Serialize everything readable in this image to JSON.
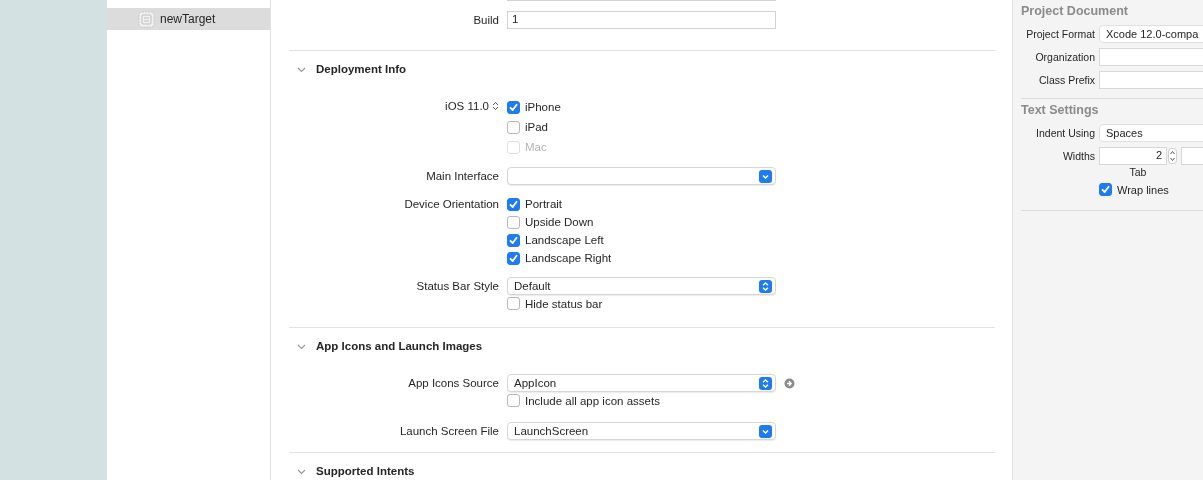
{
  "sidebar": {
    "items": [
      {
        "label": "newTarget",
        "selected": true
      }
    ]
  },
  "identity": {
    "rows": [
      {
        "kind": "field"
      },
      {
        "kind": "field",
        "label": "Build",
        "value": "1"
      }
    ]
  },
  "sections": [
    {
      "title": "Deployment Info",
      "expanded": true,
      "rows": [
        {
          "kind": "checks",
          "label": "iOS 11.0",
          "stepper": true,
          "options": [
            {
              "label": "iPhone",
              "checked": true,
              "disabled": false
            },
            {
              "label": "iPad",
              "checked": false,
              "disabled": false
            },
            {
              "label": "Mac",
              "checked": false,
              "disabled": true
            }
          ]
        },
        {
          "kind": "popup",
          "label": "Main Interface",
          "updown": false
        },
        {
          "kind": "checks",
          "label": "Device Orientation",
          "options": [
            {
              "label": "Portrait",
              "checked": true,
              "disabled": false
            },
            {
              "label": "Upside Down",
              "checked": false,
              "disabled": false
            },
            {
              "label": "Landscape Left",
              "checked": true,
              "disabled": false
            },
            {
              "label": "Landscape Right",
              "checked": true,
              "disabled": false
            }
          ]
        },
        {
          "kind": "popup",
          "label": "Status Bar Style",
          "value": "Default",
          "updown": true
        },
        {
          "kind": "check",
          "option": {
            "label": "Hide status bar",
            "checked": false,
            "disabled": false
          }
        }
      ]
    },
    {
      "title": "App Icons and Launch Images",
      "expanded": true,
      "rows": [
        {
          "kind": "popup",
          "label": "App Icons Source",
          "value": "AppIcon",
          "updown": true,
          "goto": true
        },
        {
          "kind": "check",
          "option": {
            "label": "Include all app icon assets",
            "checked": false,
            "disabled": false
          }
        },
        {
          "kind": "popup",
          "label": "Launch Screen File",
          "value": "LaunchScreen",
          "updown": false
        }
      ]
    },
    {
      "title": "Supported Intents",
      "expanded": true
    }
  ],
  "inspector": {
    "sections": [
      {
        "title": "Project Document",
        "rows": [
          {
            "kind": "popup",
            "label": "Project Format",
            "value": "Xcode 12.0-compa"
          },
          {
            "kind": "field",
            "label": "Organization"
          },
          {
            "kind": "field",
            "label": "Class Prefix"
          }
        ]
      },
      {
        "title": "Text Settings",
        "rows": [
          {
            "kind": "popup",
            "label": "Indent Using",
            "value": "Spaces"
          },
          {
            "kind": "widths",
            "label": "Widths",
            "fields": [
              {
                "kind": "stepper",
                "value": "2",
                "caption": "Tab"
              },
              {
                "kind": "field"
              }
            ]
          },
          {
            "kind": "check",
            "option": {
              "label": "Wrap lines",
              "checked": true,
              "disabled": false
            }
          }
        ]
      }
    ]
  }
}
